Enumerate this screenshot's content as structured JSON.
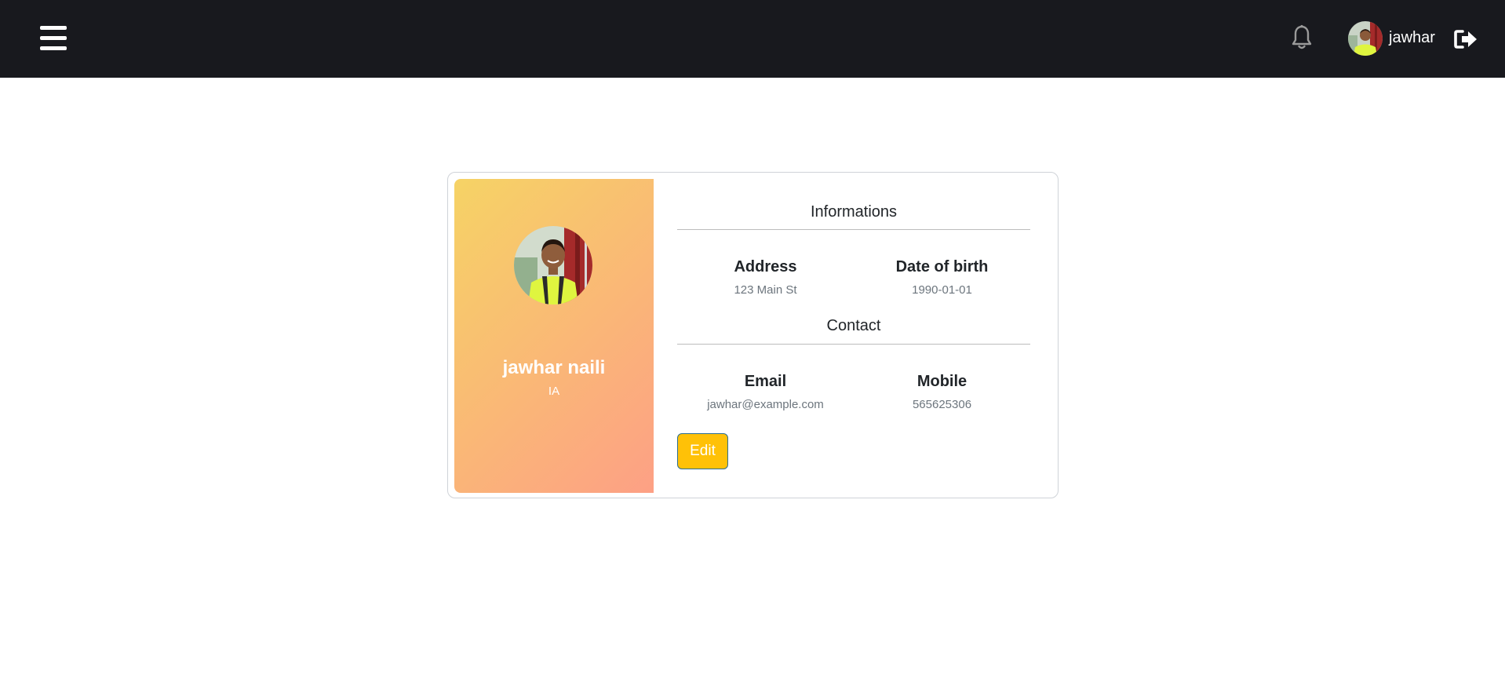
{
  "header": {
    "username": "jawhar",
    "icons": {
      "menu": "hamburger-menu-icon",
      "notifications": "bell-icon",
      "logout": "logout-icon"
    },
    "colors": {
      "background": "#18191e",
      "icon": "#ffffff"
    }
  },
  "profile": {
    "name": "jawhar naili",
    "role": "IA",
    "gradient": [
      "#f6d365",
      "#fda085"
    ]
  },
  "details": {
    "informations_title": "Informations",
    "address_label": "Address",
    "address_value": "123 Main St",
    "dob_label": "Date of birth",
    "dob_value": "1990-01-01",
    "contact_title": "Contact",
    "email_label": "Email",
    "email_value": "jawhar@example.com",
    "mobile_label": "Mobile",
    "mobile_value": "565625306",
    "edit_label": "Edit",
    "edit_color": "#ffc107"
  }
}
